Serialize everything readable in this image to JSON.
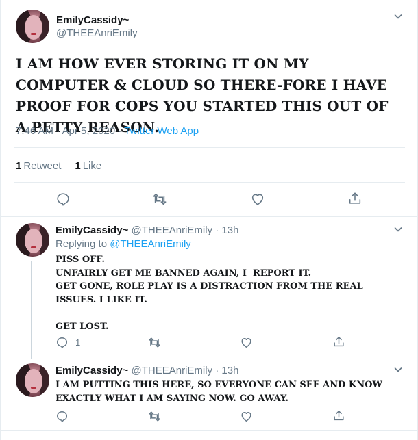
{
  "main_tweet": {
    "display_name": "EmilyCassidy~",
    "handle": "@THEEAnriEmily",
    "text": "I AM HOW EVER STORING IT ON MY COMPUTER & CLOUD SO THERE-FORE I HAVE PROOF FOR COPS YOU STARTED THIS OUT OF A PETTY REASON.",
    "time": "7:46 AM · Apr 5, 2020 · ",
    "source": "Twitter Web App",
    "retweet_count": "1",
    "retweet_label": "Retweet",
    "like_count": "1",
    "like_label": "Like"
  },
  "replies": [
    {
      "display_name": "EmilyCassidy~",
      "handle": "@THEEAnriEmily · 13h",
      "replying_prefix": "Replying to ",
      "replying_to": "@THEEAnriEmily",
      "text": "PISS OFF.\nUNFAIRLY GET ME BANNED AGAIN, I  REPORT IT.\nGET GONE, ROLE PLAY IS A DISTRACTION FROM THE REAL ISSUES. I LIKE IT.\n\nGET LOST.",
      "reply_count": "1"
    },
    {
      "display_name": "EmilyCassidy~",
      "handle": "@THEEAnriEmily · 13h",
      "text": "I AM PUTTING THIS HERE, SO EVERYONE CAN SEE AND KNOW EXACTLY WHAT I AM SAYING NOW. GO AWAY."
    }
  ],
  "colors": {
    "accent": "#1da1f2",
    "muted": "#657786",
    "text": "#14171a",
    "border": "#e6ecf0"
  },
  "icons": [
    "chevron-down-icon",
    "reply-icon",
    "retweet-icon",
    "like-icon",
    "share-icon"
  ]
}
